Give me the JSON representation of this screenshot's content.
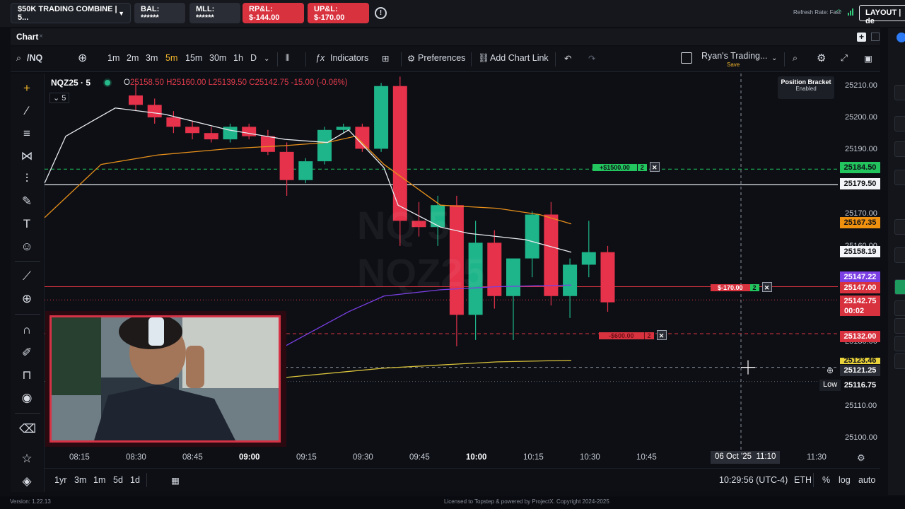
{
  "top": {
    "account": "$50K TRADING COMBINE | 5...",
    "bal": "BAL: ******",
    "mll": "MLL: ******",
    "rpl": "RP&L: $-144.00",
    "upl": "UP&L: $-170.00",
    "refresh": "Refresh Rate: Fast",
    "layout": "LAYOUT | de"
  },
  "panel": {
    "title": "Chart",
    "close": "×"
  },
  "toolbar": {
    "symbol": "/NQ",
    "timeframes": [
      "1m",
      "2m",
      "3m",
      "5m",
      "15m",
      "30m",
      "1h",
      "D"
    ],
    "active_timeframe": "5m",
    "indicators": "Indicators",
    "preferences": "Preferences",
    "add_chart_link": "Add Chart Link",
    "template_name": "Ryan's Trading...",
    "save": "Save"
  },
  "legend": {
    "symbol": "NQZ25 · 5",
    "ohlc_prefix": "O",
    "open": "25158.50",
    "high": "H25160.00",
    "low": "L25139.50",
    "close": "C25142.75",
    "change": "-15.00 (-0.06%)",
    "indicator_count": "5"
  },
  "watermark": [
    "NQ 5",
    "NQZ25"
  ],
  "position_bracket": {
    "title": "Position Bracket",
    "status": "Enabled"
  },
  "price_axis": {
    "labels": [
      "25210.00",
      "25200.00",
      "25190.00",
      "25170.00",
      "25160.00",
      "25130.00",
      "25110.00",
      "25100.00"
    ],
    "tags": [
      {
        "text": "25184.50",
        "bg": "#22c55e",
        "fg": "#0d0f15"
      },
      {
        "text": "25179.50",
        "bg": "#f2f4f7",
        "fg": "#0d0f15"
      },
      {
        "text": "25167.35",
        "bg": "#f0900f",
        "fg": "#0d0f15"
      },
      {
        "text": "25158.19",
        "bg": "#f2f4f7",
        "fg": "#0d0f15"
      },
      {
        "text": "25147.22",
        "bg": "#7b3fe4",
        "fg": "#ffffff"
      },
      {
        "text": "25147.00",
        "bg": "#d8323f",
        "fg": "#ffffff"
      },
      {
        "text": "25142.75",
        "bg": "#d8323f",
        "fg": "#ffffff"
      },
      {
        "text": "00:02",
        "bg": "#d8323f",
        "fg": "#ffffff"
      },
      {
        "text": "25132.00",
        "bg": "#d8323f",
        "fg": "#ffffff"
      },
      {
        "text": "25123.46",
        "bg": "#e9d23a",
        "fg": "#0d0f15"
      },
      {
        "text": "25121.25",
        "bg": "#2a2d35",
        "fg": "#ffffff"
      },
      {
        "text": "25116.75",
        "bg": "#0d0f15",
        "fg": "#ffffff"
      }
    ],
    "low_label": "Low"
  },
  "orders": {
    "tp": {
      "text": "+$1500.00",
      "qty": "2"
    },
    "pos": {
      "text": "$-170.00",
      "qty": "2"
    },
    "sl": {
      "text": "-$600.00",
      "qty": "2"
    }
  },
  "time_axis": {
    "labels": [
      "08:15",
      "08:30",
      "08:45",
      "09:00",
      "09:15",
      "09:30",
      "09:45",
      "10:00",
      "10:15",
      "10:30",
      "10:45",
      "11:10",
      "11:30"
    ],
    "bold": [
      "09:00",
      "10:00"
    ],
    "cursor_date": "06 Oct '25"
  },
  "bottom": {
    "ranges": [
      "1yr",
      "3m",
      "1m",
      "5d",
      "1d"
    ],
    "clock": "10:29:56 (UTC-4)",
    "session": "ETH",
    "percent": "%",
    "log": "log",
    "auto": "auto"
  },
  "footer": {
    "version": "Version: 1.22.13",
    "license": "Licensed to Topstep & powered by ProjectX. Copyright 2024-2025"
  },
  "colors": {
    "up": "#1fb58a",
    "down": "#e6324a",
    "accent": "#f0b429"
  },
  "chart_data": {
    "type": "candlestick",
    "x": [
      "08:15",
      "08:20",
      "08:25",
      "08:30",
      "08:35",
      "08:40",
      "08:45",
      "08:50",
      "08:55",
      "09:00",
      "09:05",
      "09:10",
      "09:15",
      "09:20",
      "09:25",
      "09:30",
      "09:35",
      "09:40",
      "09:45",
      "09:50",
      "09:55",
      "10:00",
      "10:05",
      "10:10",
      "10:15",
      "10:20",
      "10:25"
    ],
    "candles": [
      [
        25208,
        25212,
        25203,
        25205
      ],
      [
        25205,
        25207,
        25199,
        25201
      ],
      [
        25201,
        25203,
        25196,
        25198
      ],
      [
        25198,
        25200,
        25194,
        25196
      ],
      [
        25196,
        25198,
        25193,
        25194
      ],
      [
        25194,
        25199,
        25193,
        25198
      ],
      [
        25198,
        25199,
        25194,
        25195
      ],
      [
        25195,
        25197,
        25189,
        25190
      ],
      [
        25190,
        25193,
        25176,
        25181
      ],
      [
        25181,
        25188,
        25180,
        25187
      ],
      [
        25187,
        25198,
        25186,
        25197
      ],
      [
        25197,
        25199,
        25196,
        25198
      ],
      [
        25198,
        25199,
        25190,
        25191
      ],
      [
        25191,
        25212,
        25190,
        25211
      ],
      [
        25211,
        25214,
        25160,
        25168
      ],
      [
        25168,
        25174,
        25163,
        25166
      ],
      [
        25166,
        25176,
        25160,
        25173
      ],
      [
        25173,
        25176,
        25128,
        25138
      ],
      [
        25138,
        25168,
        25130,
        25161
      ],
      [
        25161,
        25165,
        25140,
        25144
      ],
      [
        25144,
        25151,
        25130,
        25156
      ],
      [
        25156,
        25171,
        25150,
        25170
      ],
      [
        25170,
        25174,
        25141,
        25144
      ],
      [
        25144,
        25156,
        25137,
        25154
      ],
      [
        25154,
        25168,
        25150,
        25158
      ],
      [
        25158,
        25160,
        25139,
        25142
      ]
    ],
    "ylim": [
      25095,
      25215
    ]
  }
}
